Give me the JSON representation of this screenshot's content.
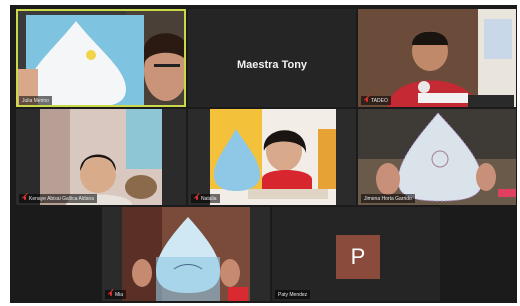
{
  "host": {
    "name": "Maestra Tony"
  },
  "participants": [
    {
      "key": "julia",
      "name": "Julia Merino",
      "active": true
    },
    {
      "key": "tadeo",
      "name": "TADEO"
    },
    {
      "key": "kenaye",
      "name": "Kenaye Abisai Gallica Aldana"
    },
    {
      "key": "natalia",
      "name": "Natalia"
    },
    {
      "key": "jimena",
      "name": "Jimena Horta Garrido"
    },
    {
      "key": "mia",
      "name": "Mia"
    },
    {
      "key": "paty",
      "name": "Paty Mendez",
      "avatar_letter": "P",
      "avatar_color": "#8a4b3c"
    }
  ],
  "colors": {
    "background": "#1b1b1b",
    "active_border": "#c9d94a",
    "muted_icon": "#e03030"
  }
}
